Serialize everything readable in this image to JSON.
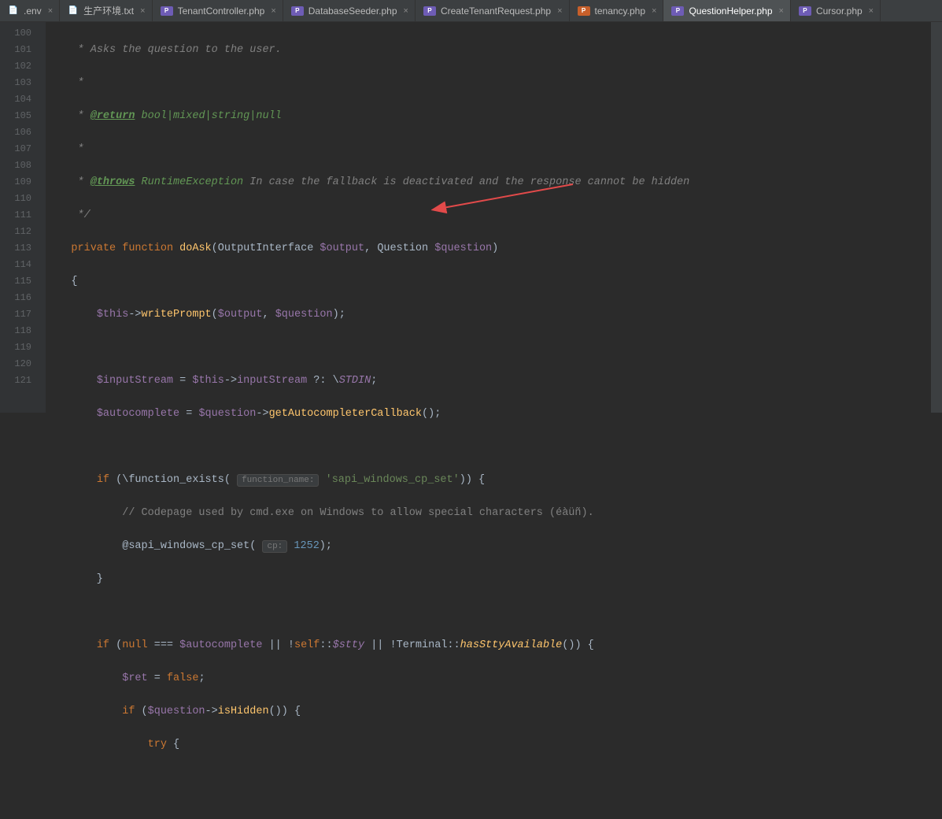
{
  "tabs": [
    {
      "icon": "txt",
      "label": ".env"
    },
    {
      "icon": "txt",
      "label": "生产环境.txt"
    },
    {
      "icon": "php",
      "label": "TenantController.php"
    },
    {
      "icon": "php",
      "label": "DatabaseSeeder.php"
    },
    {
      "icon": "php",
      "label": "CreateTenantRequest.php"
    },
    {
      "icon": "php-orange",
      "label": "tenancy.php"
    },
    {
      "icon": "php",
      "label": "QuestionHelper.php",
      "active": true
    },
    {
      "icon": "php",
      "label": "Cursor.php"
    }
  ],
  "lines": {
    "start": 100,
    "end": 121
  },
  "code": {
    "l100": {
      "pre": "     * ",
      "text": "Asks the question to the user."
    },
    "l101": {
      "pre": "     *"
    },
    "l102": {
      "pre": "     * ",
      "tag": "@return",
      "rest": " bool|mixed|string|null"
    },
    "l103": {
      "pre": "     *"
    },
    "l104": {
      "pre": "     * ",
      "tag": "@throws",
      "cls": " RuntimeException",
      "rest": " In case the fallback is deactivated and the response cannot be hidden"
    },
    "l105": {
      "pre": "     */"
    },
    "l106": {
      "kw1": "private",
      "kw2": "function",
      "name": "doAsk",
      "sig_a": "(OutputInterface ",
      "p1": "$output",
      "sig_b": ", Question ",
      "p2": "$question",
      "sig_c": ")"
    },
    "l107": {
      "brace": "    {"
    },
    "l108": {
      "ind": "        ",
      "this": "$this",
      "arrow": "->",
      "m": "writePrompt",
      "a": "(",
      "v1": "$output",
      "c": ", ",
      "v2": "$question",
      "e": ");"
    },
    "l110": {
      "ind": "        ",
      "v": "$inputStream",
      "eq": " = ",
      "this": "$this",
      "arrow": "->",
      "prop": "inputStream",
      "op": " ?: \\",
      "const": "STDIN",
      "e": ";"
    },
    "l111": {
      "ind": "        ",
      "v": "$autocomplete",
      "eq": " = ",
      "v2": "$question",
      "arrow": "->",
      "m": "getAutocompleterCallback",
      "e": "();"
    },
    "l113": {
      "ind": "        ",
      "kw": "if",
      "a": " (\\",
      "fn": "function_exists",
      "b": "( ",
      "hint": "function_name:",
      "sp": " ",
      "str": "'sapi_windows_cp_set'",
      "e": ")) {"
    },
    "l114": {
      "ind": "            ",
      "cmt": "// Codepage used by cmd.exe on Windows to allow special characters (éàüñ)."
    },
    "l115": {
      "ind": "            ",
      "at": "@",
      "fn": "sapi_windows_cp_set",
      "a": "( ",
      "hint": "cp:",
      "sp": " ",
      "num": "1252",
      "e": ");"
    },
    "l116": {
      "ind": "        }",
      "e": ""
    },
    "l118": {
      "ind": "        ",
      "kw": "if",
      "a": " (",
      "nul": "null",
      "op": " === ",
      "v": "$autocomplete",
      "or1": " || !",
      "self": "self",
      "cc": "::",
      "stty": "$stty",
      "or2": " || !Terminal::",
      "m": "hasSttyAvailable",
      "e": "()) {"
    },
    "l119": {
      "ind": "            ",
      "v": "$ret",
      "eq": " = ",
      "val": "false",
      "e": ";"
    },
    "l120": {
      "ind": "            ",
      "kw": "if",
      "a": " (",
      "v": "$question",
      "arrow": "->",
      "m": "isHidden",
      "e": "()) {"
    },
    "l121": {
      "ind": "                ",
      "kw": "try",
      "e": " {"
    }
  }
}
